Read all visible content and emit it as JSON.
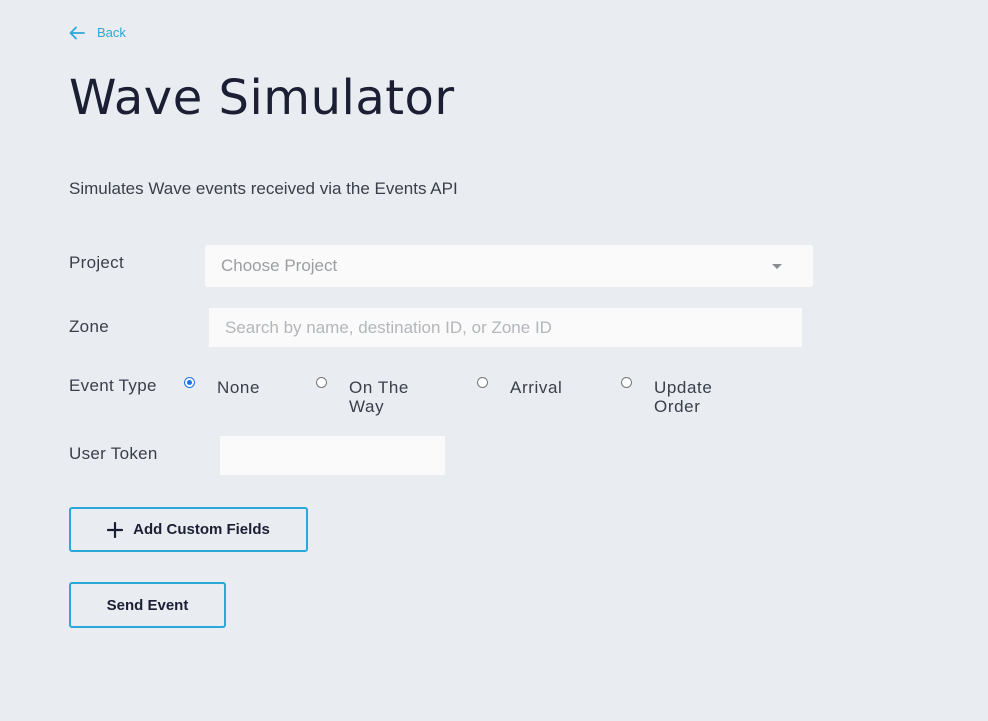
{
  "header": {
    "back_label": "Back",
    "title": "Wave Simulator",
    "description": "Simulates Wave events received via the Events API"
  },
  "form": {
    "project": {
      "label": "Project",
      "placeholder": "Choose Project"
    },
    "zone": {
      "label": "Zone",
      "placeholder": "Search by name, destination ID, or Zone ID",
      "value": ""
    },
    "event_type": {
      "label": "Event Type",
      "selected": "None",
      "options": [
        {
          "label": "None",
          "checked": true
        },
        {
          "label": "On The Way",
          "checked": false
        },
        {
          "label": "Arrival",
          "checked": false
        },
        {
          "label": "Update Order",
          "checked": false
        }
      ]
    },
    "user_token": {
      "label": "User Token",
      "value": ""
    }
  },
  "actions": {
    "add_custom_fields_label": "Add Custom Fields",
    "send_event_label": "Send Event"
  },
  "colors": {
    "background": "#e9edf1",
    "accent": "#2aa8d8",
    "title": "#1c1f33",
    "radio_checked": "#1a73e8"
  },
  "icons": {
    "back": "arrow-left-icon",
    "dropdown": "caret-down-icon",
    "add": "plus-icon"
  }
}
